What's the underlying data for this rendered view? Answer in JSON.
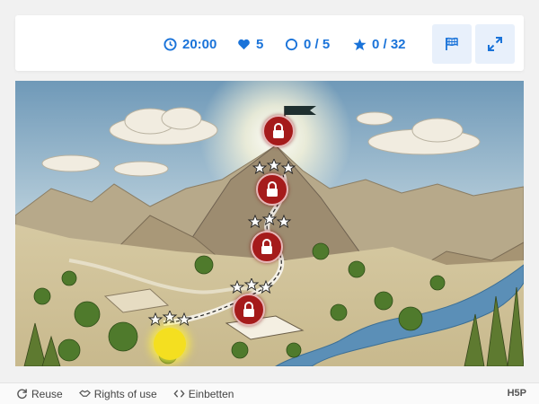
{
  "topbar": {
    "timer": "20:00",
    "lives": "5",
    "stages": "0 / 5",
    "stars": "0 / 32",
    "icons": {
      "timer": "clock-icon",
      "lives": "heart-icon",
      "stages": "circle-icon",
      "stars": "star-icon",
      "flag": "flag-icon",
      "fullscreen": "expand-icon"
    }
  },
  "map": {
    "stages": [
      {
        "status": "locked",
        "stars": 0
      },
      {
        "status": "locked",
        "stars": 0
      },
      {
        "status": "locked",
        "stars": 0
      },
      {
        "status": "locked",
        "stars": 0
      },
      {
        "status": "locked",
        "stars": 0
      }
    ],
    "start": {
      "status": "current"
    }
  },
  "footer": {
    "reuse": "Reuse",
    "rights": "Rights of use",
    "embed": "Einbetten",
    "logo": "H5P"
  },
  "colors": {
    "accent": "#1a73d9",
    "lock": "#a51b1b",
    "start": "#f4df20"
  }
}
